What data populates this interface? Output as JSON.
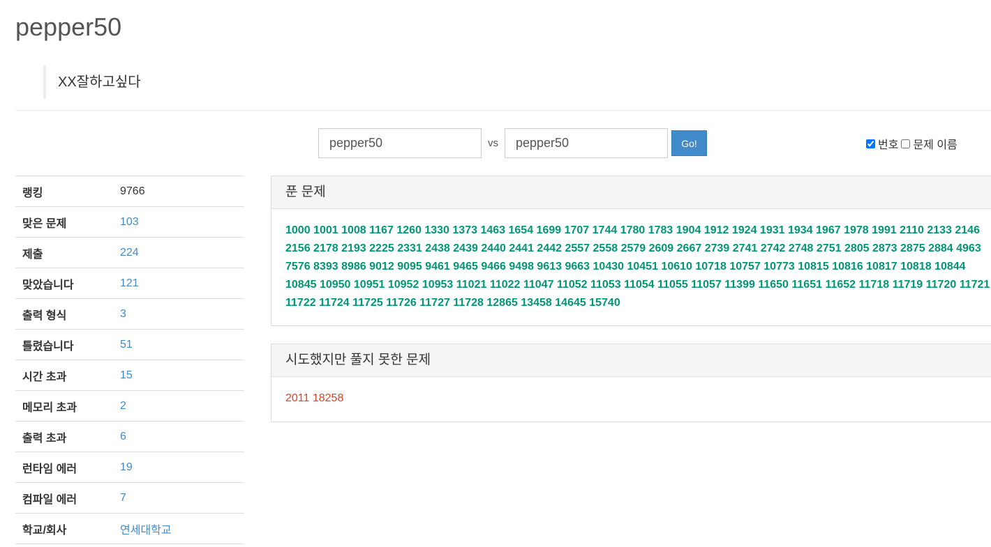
{
  "profile": {
    "username": "pepper50",
    "status_message": "XX잘하고싶다"
  },
  "vs": {
    "left_value": "pepper50",
    "vs_label": "vs",
    "right_value": "pepper50",
    "go_label": "Go!"
  },
  "view_options": {
    "number_label": "번호",
    "number_checked": true,
    "title_label": "문제 이름",
    "title_checked": false
  },
  "stats": [
    {
      "label": "랭킹",
      "value": "9766",
      "link": false
    },
    {
      "label": "맞은 문제",
      "value": "103",
      "link": true
    },
    {
      "label": "제출",
      "value": "224",
      "link": true
    },
    {
      "label": "맞았습니다",
      "value": "121",
      "link": true
    },
    {
      "label": "출력 형식",
      "value": "3",
      "link": true
    },
    {
      "label": "틀렸습니다",
      "value": "51",
      "link": true
    },
    {
      "label": "시간 초과",
      "value": "15",
      "link": true
    },
    {
      "label": "메모리 초과",
      "value": "2",
      "link": true
    },
    {
      "label": "출력 초과",
      "value": "6",
      "link": true
    },
    {
      "label": "런타임 에러",
      "value": "19",
      "link": true
    },
    {
      "label": "컴파일 에러",
      "value": "7",
      "link": true
    },
    {
      "label": "학교/회사",
      "value": "연세대학교",
      "link": true
    }
  ],
  "solved_panel": {
    "title": "푼 문제",
    "problems": [
      "1000",
      "1001",
      "1008",
      "1167",
      "1260",
      "1330",
      "1373",
      "1463",
      "1654",
      "1699",
      "1707",
      "1744",
      "1780",
      "1783",
      "1904",
      "1912",
      "1924",
      "1931",
      "1934",
      "1967",
      "1978",
      "1991",
      "2110",
      "2133",
      "2146",
      "2156",
      "2178",
      "2193",
      "2225",
      "2331",
      "2438",
      "2439",
      "2440",
      "2441",
      "2442",
      "2557",
      "2558",
      "2579",
      "2609",
      "2667",
      "2739",
      "2741",
      "2742",
      "2748",
      "2751",
      "2805",
      "2873",
      "2875",
      "2884",
      "4963",
      "7576",
      "8393",
      "8986",
      "9012",
      "9095",
      "9461",
      "9465",
      "9466",
      "9498",
      "9613",
      "9663",
      "10430",
      "10451",
      "10610",
      "10718",
      "10757",
      "10773",
      "10815",
      "10816",
      "10817",
      "10818",
      "10844",
      "10845",
      "10950",
      "10951",
      "10952",
      "10953",
      "11021",
      "11022",
      "11047",
      "11052",
      "11053",
      "11054",
      "11055",
      "11057",
      "11399",
      "11650",
      "11651",
      "11652",
      "11718",
      "11719",
      "11720",
      "11721",
      "11722",
      "11724",
      "11725",
      "11726",
      "11727",
      "11728",
      "12865",
      "13458",
      "14645",
      "15740"
    ]
  },
  "tried_panel": {
    "title": "시도했지만 풀지 못한 문제",
    "problems": [
      "2011",
      "18258"
    ]
  },
  "colors": {
    "solved": "#009874",
    "failed": "#dd4124",
    "link": "#428bca",
    "button": "#428bca"
  }
}
